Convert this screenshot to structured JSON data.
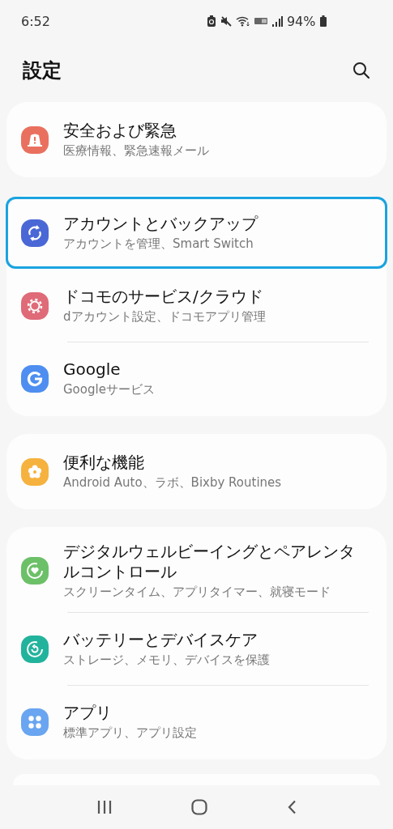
{
  "status_bar": {
    "time": "6:52",
    "battery": "94%"
  },
  "header": {
    "title": "設定"
  },
  "groups": [
    {
      "items": [
        {
          "kind": "alert",
          "color": "#e9705f",
          "title": "安全および緊急",
          "subtitle": "医療情報、緊急速報メール",
          "highlighted": false
        }
      ]
    },
    {
      "items": [
        {
          "kind": "sync",
          "color": "#4a67d6",
          "title": "アカウントとバックアップ",
          "subtitle": "アカウントを管理、Smart Switch",
          "highlighted": true
        },
        {
          "kind": "gear",
          "color": "#df6a78",
          "title": "ドコモのサービス/クラウド",
          "subtitle": "dアカウント設定、ドコモアプリ管理",
          "highlighted": false
        },
        {
          "kind": "google",
          "color": "#4e8ef0",
          "title": "Google",
          "subtitle": "Googleサービス",
          "highlighted": false
        }
      ]
    },
    {
      "items": [
        {
          "kind": "flower",
          "color": "#f6b23e",
          "title": "便利な機能",
          "subtitle": "Android Auto、ラボ、Bixby Routines",
          "highlighted": false
        }
      ]
    },
    {
      "items": [
        {
          "kind": "wellbeing",
          "color": "#6cc068",
          "title": "デジタルウェルビーイングとペアレンタルコントロール",
          "subtitle": "スクリーンタイム、アプリタイマー、就寝モード",
          "highlighted": false
        },
        {
          "kind": "care",
          "color": "#22b39c",
          "title": "バッテリーとデバイスケア",
          "subtitle": "ストレージ、メモリ、デバイスを保護",
          "highlighted": false
        },
        {
          "kind": "apps",
          "color": "#69a5f0",
          "title": "アプリ",
          "subtitle": "標準アプリ、アプリ設定",
          "highlighted": false
        }
      ]
    }
  ]
}
